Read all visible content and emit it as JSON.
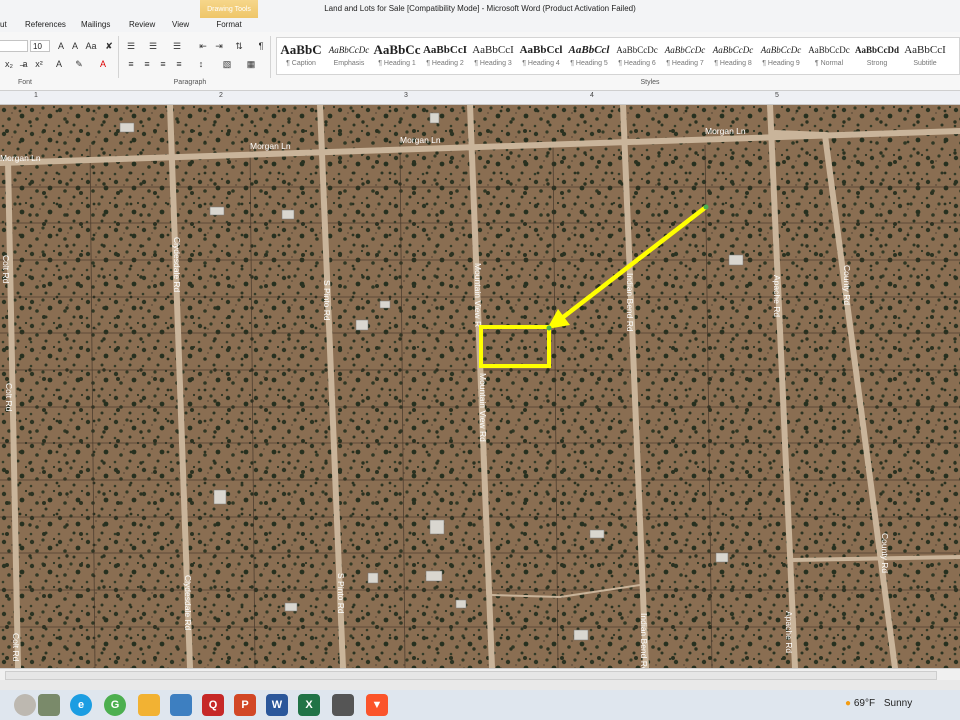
{
  "window": {
    "title": "Land and Lots for Sale [Compatibility Mode]  -  Microsoft Word (Product Activation Failed)",
    "contextual_tab_group": "Drawing Tools"
  },
  "ribbon_tabs": [
    "ut",
    "References",
    "Mailings",
    "Review",
    "View",
    "Format"
  ],
  "font_group": {
    "label": "Font",
    "font_size": "10"
  },
  "paragraph_group": {
    "label": "Paragraph"
  },
  "styles_group": {
    "label": "Styles",
    "items": [
      {
        "sample": "AaBbC",
        "name": "¶ Caption"
      },
      {
        "sample": "AaBbCcDc",
        "name": "Emphasis"
      },
      {
        "sample": "AaBbCc",
        "name": "¶ Heading 1"
      },
      {
        "sample": "AaBbCcI",
        "name": "¶ Heading 2"
      },
      {
        "sample": "AaBbCcI",
        "name": "¶ Heading 3"
      },
      {
        "sample": "AaBbCcl",
        "name": "¶ Heading 4"
      },
      {
        "sample": "AaBbCcl",
        "name": "¶ Heading 5"
      },
      {
        "sample": "AaBbCcDc",
        "name": "¶ Heading 6"
      },
      {
        "sample": "AaBbCcDc",
        "name": "¶ Heading 7"
      },
      {
        "sample": "AaBbCcDc",
        "name": "¶ Heading 8"
      },
      {
        "sample": "AaBbCcDc",
        "name": "¶ Heading 9"
      },
      {
        "sample": "AaBbCcDc",
        "name": "¶ Normal"
      },
      {
        "sample": "AaBbCcDd",
        "name": "Strong"
      },
      {
        "sample": "AaBbCcI",
        "name": "Subtitle"
      }
    ]
  },
  "ruler": {
    "numbers": [
      "1",
      "2",
      "3",
      "4",
      "5"
    ]
  },
  "map": {
    "roads": {
      "morgan_1": "Morgan Ln",
      "morgan_2": "Morgan Ln",
      "morgan_3": "Morgan Ln",
      "morgan_4": "Morgan Ln",
      "colt_1": "Colt Rd",
      "colt_2": "Colt Rd",
      "colt_3": "Colt Rd",
      "clydesdale_1": "Clydesdale Rd",
      "clydesdale_2": "Clydesdale Rd",
      "pinto_1": "S Pinto Rd",
      "pinto_2": "S Pinto Rd",
      "mountain_1": "Mountain View R",
      "mountain_2": "Mountain View Rd",
      "indian_1": "Indian Bend Rd",
      "indian_2": "Indian Bend Rd",
      "apache_1": "Apache Rd",
      "apache_2": "Apache Rd",
      "county_1": "County Rd",
      "county_2": "County Rd"
    },
    "colors": {
      "terrain": "#8a6e52",
      "road": "#c9b49a",
      "highlight": "#ffff00",
      "brush": "#2b3322"
    }
  },
  "taskbar": {
    "weather_temp": "69°F",
    "weather_condition": "Sunny",
    "icons": [
      "avatar",
      "edge-icon",
      "chrome-icon",
      "file-explorer-icon",
      "store-icon",
      "quicken-icon",
      "powerpoint-icon",
      "word-icon",
      "excel-icon",
      "car-icon",
      "brave-icon"
    ]
  }
}
